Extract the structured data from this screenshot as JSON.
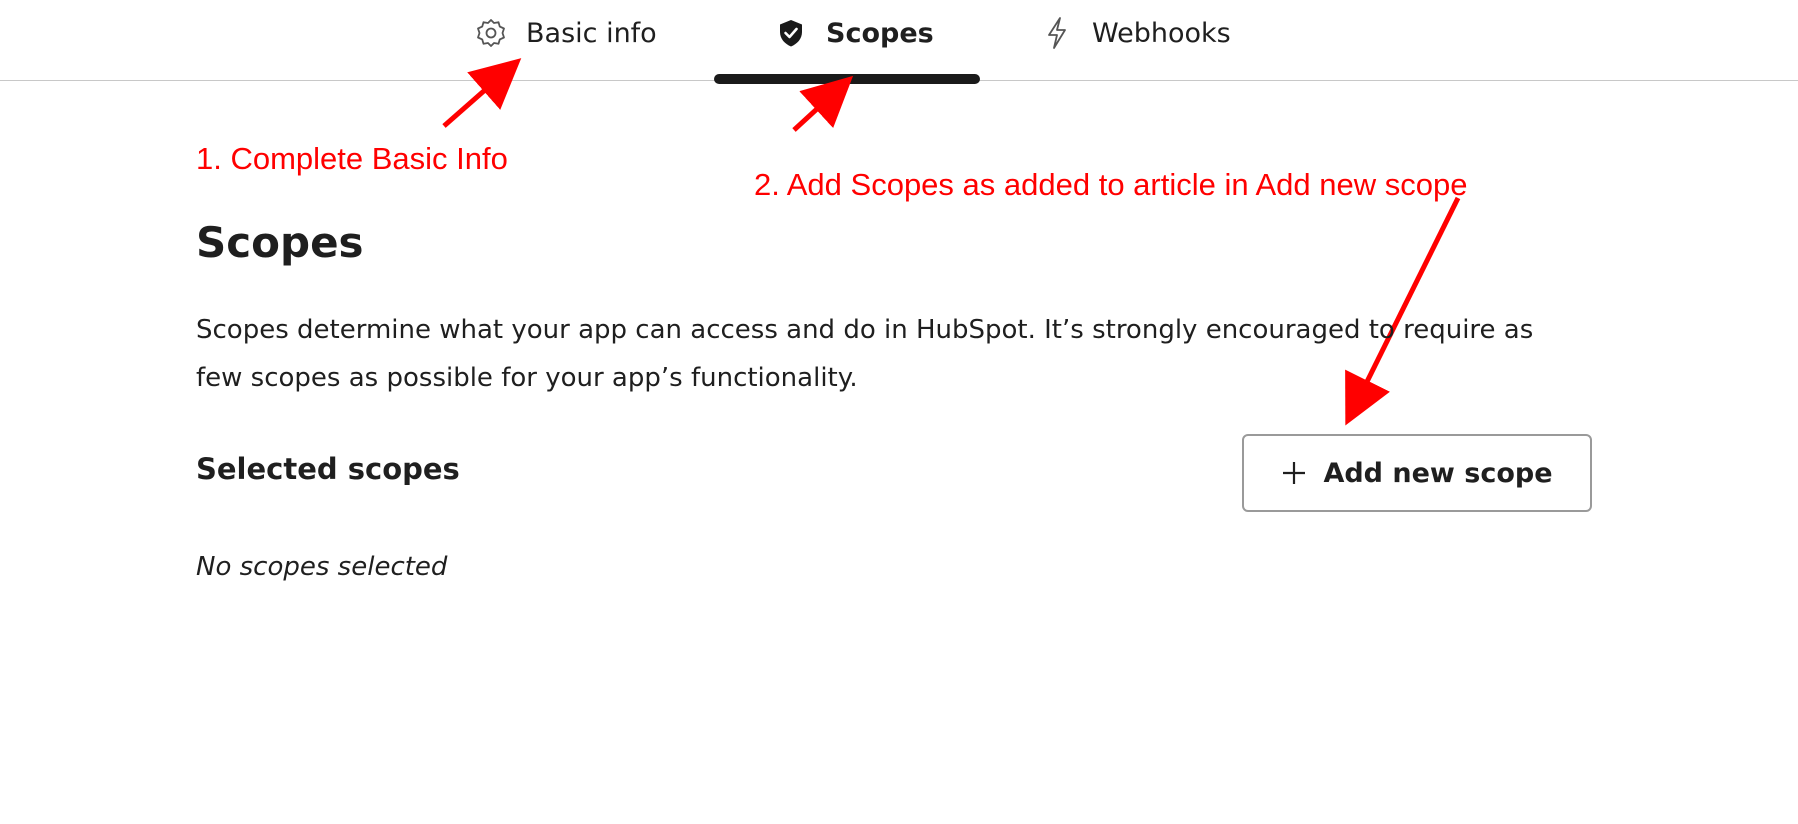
{
  "tabs": [
    {
      "label": "Basic info",
      "icon": "gear-icon",
      "active": false
    },
    {
      "label": "Scopes",
      "icon": "shield-check-icon",
      "active": true
    },
    {
      "label": "Webhooks",
      "icon": "lightning-icon",
      "active": false
    }
  ],
  "annotations": {
    "step1": "1. Complete Basic Info",
    "step2": "2. Add Scopes as added to article in Add new scope",
    "color": "#ff0000"
  },
  "main": {
    "title": "Scopes",
    "description": "Scopes determine what your app can access and do in HubSpot. It’s strongly encouraged to require as few scopes as possible for your app’s functionality.",
    "section_heading": "Selected scopes",
    "add_button_label": "Add new scope",
    "add_button_icon": "plus-icon",
    "empty_state": "No scopes selected"
  }
}
